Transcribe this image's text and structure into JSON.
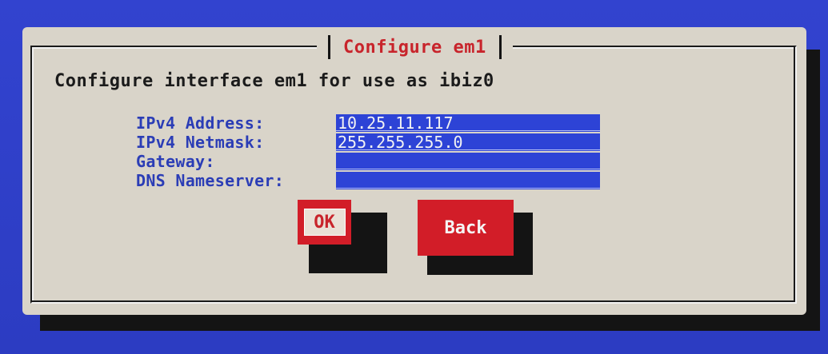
{
  "dialog": {
    "title": "Configure em1",
    "description": "Configure interface em1 for use as ibiz0"
  },
  "form": {
    "fields": [
      {
        "label": "IPv4 Address:",
        "value": "10.25.11.117"
      },
      {
        "label": "IPv4 Netmask:",
        "value": "255.255.255.0"
      },
      {
        "label": "Gateway:",
        "value": ""
      },
      {
        "label": "DNS Nameserver:",
        "value": ""
      }
    ]
  },
  "buttons": {
    "ok_label": "OK",
    "back_label": "Back"
  },
  "colors": {
    "background": "#2d3ec7",
    "dialog_bg": "#d9d4c9",
    "title_red": "#c8242b",
    "label_blue": "#2b3db6",
    "field_blue": "#2d43d6",
    "button_red": "#d21d28"
  }
}
